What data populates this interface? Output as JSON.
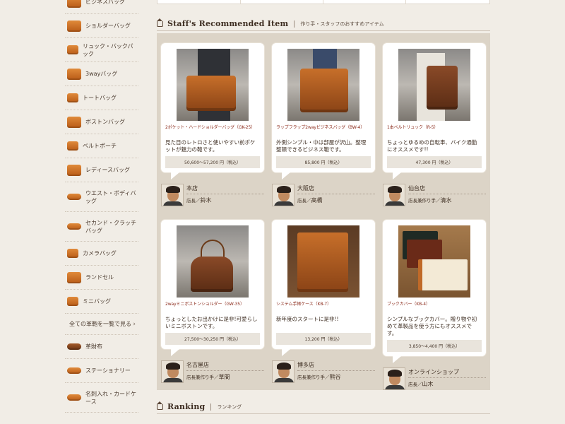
{
  "sidebar": {
    "items": [
      {
        "label": "ビジネスバッグ"
      },
      {
        "label": "ショルダーバッグ"
      },
      {
        "label": "リュック・バックパック"
      },
      {
        "label": "3wayバッグ"
      },
      {
        "label": "トートバッグ"
      },
      {
        "label": "ボストンバッグ"
      },
      {
        "label": "ベルトポーチ"
      },
      {
        "label": "レディースバッグ"
      },
      {
        "label": "ウエスト・ボディバッグ"
      },
      {
        "label": "セカンド・クラッチバッグ"
      },
      {
        "label": "カメラバッグ"
      },
      {
        "label": "ランドセル"
      },
      {
        "label": "ミニバッグ"
      }
    ],
    "all_link": "全ての革鞄を一覧で見る",
    "items2": [
      {
        "label": "革財布"
      },
      {
        "label": "ステーショナリー"
      },
      {
        "label": "名刺入れ・カードケース"
      }
    ]
  },
  "recommended": {
    "title": "Staff's Recommended Item",
    "subtitle": "作り手・スタッフのおすすめアイテム",
    "cards": [
      {
        "name": "2ポケット・ハードショルダーバッグ（GK-25）",
        "desc": "見た目のレトロさと使いやすい前ポケットが魅力の鞄です。",
        "price": "50,600〜57,200 円（税込）",
        "store": "本店",
        "role": "店長",
        "staff": "鈴木"
      },
      {
        "name": "ラップフラップ2wayビジネスバッグ（BW-4）",
        "desc": "外側シンプル・中は部屋が沢山。整理整頓できるビジネス鞄です。",
        "price": "85,800 円（税込）",
        "store": "大阪店",
        "role": "店長",
        "staff": "高橋"
      },
      {
        "name": "1本ベルトリュック（R-5）",
        "desc": "ちょっとゆるめの自転車、バイク通勤にオススメです!!",
        "price": "47,300 円（税込）",
        "store": "仙台店",
        "role": "店長兼作り手",
        "staff": "清水"
      },
      {
        "name": "2wayミニボストンショルダー（GW-35）",
        "desc": "ちょっとしたお出かけに是非!可愛らしいミニボストンです。",
        "price": "27,500〜30,250 円（税込）",
        "store": "名古屋店",
        "role": "店長兼作り手",
        "staff": "草間"
      },
      {
        "name": "システム手帳ケース（KB-7）",
        "desc": "新年度のスタートに是非!!",
        "price": "13,200 円（税込）",
        "store": "博多店",
        "role": "店長兼作り手",
        "staff": "熊谷"
      },
      {
        "name": "ブックカバー（KB-4）",
        "desc": "シンプルなブックカバー。贈り物や初めて革製品を使う方にもオススメです。",
        "price": "3,850〜4,400 円（税込）",
        "store": "オンラインショップ",
        "role": "店長",
        "staff": "山木"
      }
    ]
  },
  "ranking": {
    "title": "Ranking",
    "subtitle": "ランキング"
  },
  "colors": {
    "accent": "#8b2a1a",
    "panel": "#dcd4c7",
    "page_bg": "#f1ede6"
  }
}
